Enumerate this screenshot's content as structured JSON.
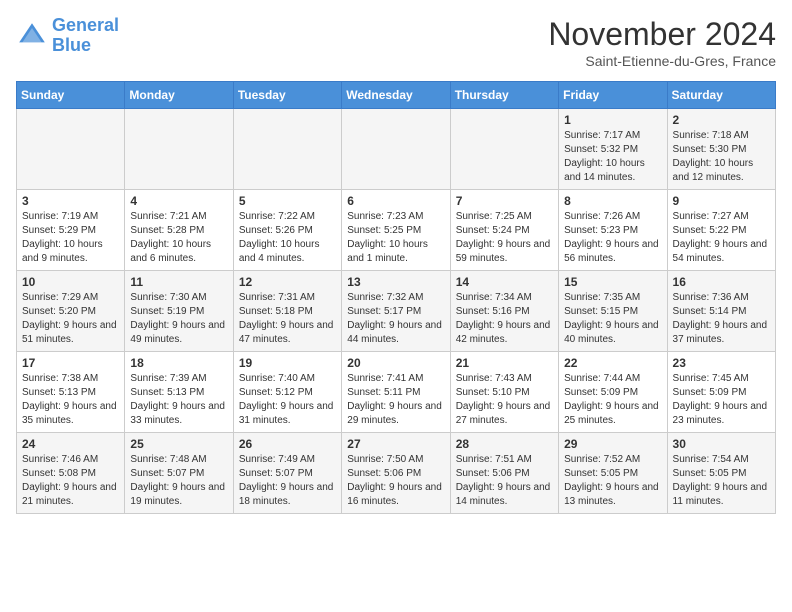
{
  "logo": {
    "line1": "General",
    "line2": "Blue"
  },
  "title": "November 2024",
  "subtitle": "Saint-Etienne-du-Gres, France",
  "weekdays": [
    "Sunday",
    "Monday",
    "Tuesday",
    "Wednesday",
    "Thursday",
    "Friday",
    "Saturday"
  ],
  "weeks": [
    [
      {
        "day": "",
        "info": ""
      },
      {
        "day": "",
        "info": ""
      },
      {
        "day": "",
        "info": ""
      },
      {
        "day": "",
        "info": ""
      },
      {
        "day": "",
        "info": ""
      },
      {
        "day": "1",
        "info": "Sunrise: 7:17 AM\nSunset: 5:32 PM\nDaylight: 10 hours and 14 minutes."
      },
      {
        "day": "2",
        "info": "Sunrise: 7:18 AM\nSunset: 5:30 PM\nDaylight: 10 hours and 12 minutes."
      }
    ],
    [
      {
        "day": "3",
        "info": "Sunrise: 7:19 AM\nSunset: 5:29 PM\nDaylight: 10 hours and 9 minutes."
      },
      {
        "day": "4",
        "info": "Sunrise: 7:21 AM\nSunset: 5:28 PM\nDaylight: 10 hours and 6 minutes."
      },
      {
        "day": "5",
        "info": "Sunrise: 7:22 AM\nSunset: 5:26 PM\nDaylight: 10 hours and 4 minutes."
      },
      {
        "day": "6",
        "info": "Sunrise: 7:23 AM\nSunset: 5:25 PM\nDaylight: 10 hours and 1 minute."
      },
      {
        "day": "7",
        "info": "Sunrise: 7:25 AM\nSunset: 5:24 PM\nDaylight: 9 hours and 59 minutes."
      },
      {
        "day": "8",
        "info": "Sunrise: 7:26 AM\nSunset: 5:23 PM\nDaylight: 9 hours and 56 minutes."
      },
      {
        "day": "9",
        "info": "Sunrise: 7:27 AM\nSunset: 5:22 PM\nDaylight: 9 hours and 54 minutes."
      }
    ],
    [
      {
        "day": "10",
        "info": "Sunrise: 7:29 AM\nSunset: 5:20 PM\nDaylight: 9 hours and 51 minutes."
      },
      {
        "day": "11",
        "info": "Sunrise: 7:30 AM\nSunset: 5:19 PM\nDaylight: 9 hours and 49 minutes."
      },
      {
        "day": "12",
        "info": "Sunrise: 7:31 AM\nSunset: 5:18 PM\nDaylight: 9 hours and 47 minutes."
      },
      {
        "day": "13",
        "info": "Sunrise: 7:32 AM\nSunset: 5:17 PM\nDaylight: 9 hours and 44 minutes."
      },
      {
        "day": "14",
        "info": "Sunrise: 7:34 AM\nSunset: 5:16 PM\nDaylight: 9 hours and 42 minutes."
      },
      {
        "day": "15",
        "info": "Sunrise: 7:35 AM\nSunset: 5:15 PM\nDaylight: 9 hours and 40 minutes."
      },
      {
        "day": "16",
        "info": "Sunrise: 7:36 AM\nSunset: 5:14 PM\nDaylight: 9 hours and 37 minutes."
      }
    ],
    [
      {
        "day": "17",
        "info": "Sunrise: 7:38 AM\nSunset: 5:13 PM\nDaylight: 9 hours and 35 minutes."
      },
      {
        "day": "18",
        "info": "Sunrise: 7:39 AM\nSunset: 5:13 PM\nDaylight: 9 hours and 33 minutes."
      },
      {
        "day": "19",
        "info": "Sunrise: 7:40 AM\nSunset: 5:12 PM\nDaylight: 9 hours and 31 minutes."
      },
      {
        "day": "20",
        "info": "Sunrise: 7:41 AM\nSunset: 5:11 PM\nDaylight: 9 hours and 29 minutes."
      },
      {
        "day": "21",
        "info": "Sunrise: 7:43 AM\nSunset: 5:10 PM\nDaylight: 9 hours and 27 minutes."
      },
      {
        "day": "22",
        "info": "Sunrise: 7:44 AM\nSunset: 5:09 PM\nDaylight: 9 hours and 25 minutes."
      },
      {
        "day": "23",
        "info": "Sunrise: 7:45 AM\nSunset: 5:09 PM\nDaylight: 9 hours and 23 minutes."
      }
    ],
    [
      {
        "day": "24",
        "info": "Sunrise: 7:46 AM\nSunset: 5:08 PM\nDaylight: 9 hours and 21 minutes."
      },
      {
        "day": "25",
        "info": "Sunrise: 7:48 AM\nSunset: 5:07 PM\nDaylight: 9 hours and 19 minutes."
      },
      {
        "day": "26",
        "info": "Sunrise: 7:49 AM\nSunset: 5:07 PM\nDaylight: 9 hours and 18 minutes."
      },
      {
        "day": "27",
        "info": "Sunrise: 7:50 AM\nSunset: 5:06 PM\nDaylight: 9 hours and 16 minutes."
      },
      {
        "day": "28",
        "info": "Sunrise: 7:51 AM\nSunset: 5:06 PM\nDaylight: 9 hours and 14 minutes."
      },
      {
        "day": "29",
        "info": "Sunrise: 7:52 AM\nSunset: 5:05 PM\nDaylight: 9 hours and 13 minutes."
      },
      {
        "day": "30",
        "info": "Sunrise: 7:54 AM\nSunset: 5:05 PM\nDaylight: 9 hours and 11 minutes."
      }
    ]
  ]
}
